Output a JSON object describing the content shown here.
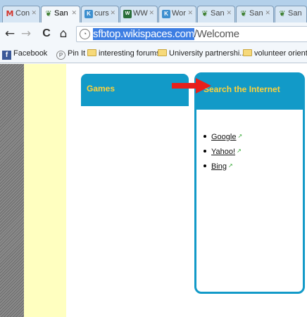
{
  "tabs": [
    {
      "label": "Con",
      "icon": "gmail-icon",
      "glyph": "M",
      "active": false
    },
    {
      "label": "San",
      "icon": "plant-icon",
      "glyph": "❦",
      "active": true
    },
    {
      "label": "curs",
      "icon": "k12-icon",
      "glyph": "K",
      "active": false
    },
    {
      "label": "WW",
      "icon": "ww-icon",
      "glyph": "W",
      "active": false
    },
    {
      "label": "Wor",
      "icon": "k12-icon",
      "glyph": "K",
      "active": false
    },
    {
      "label": "San",
      "icon": "plant-icon",
      "glyph": "❦",
      "active": false
    },
    {
      "label": "San",
      "icon": "plant-icon",
      "glyph": "❦",
      "active": false
    },
    {
      "label": "San",
      "icon": "plant-icon",
      "glyph": "❦",
      "active": false
    }
  ],
  "nav": {
    "back": "←",
    "forward": "→",
    "reload": "C",
    "home": "⌂"
  },
  "omnibox": {
    "url_selected": "sfbtop.wikispaces.com",
    "url_rest": "/Welcome"
  },
  "bookmarks": [
    {
      "label": "Facebook",
      "icon": "facebook-icon"
    },
    {
      "label": "Pin It",
      "icon": "pinit-icon"
    },
    {
      "label": "interesting forums",
      "icon": "folder-icon"
    },
    {
      "label": "University partnershi...",
      "icon": "folder-icon"
    },
    {
      "label": "volunteer orientations",
      "icon": "folder-icon"
    }
  ],
  "page": {
    "games_title": "Games",
    "search_title": "Search the Internet",
    "search_links": [
      "Google",
      "Yahoo!",
      "Bing"
    ]
  },
  "colors": {
    "box_blue": "#129ac8",
    "heading_yellow": "#ffd23a",
    "left_column": "#ffffc0",
    "arrow_red": "#e8201b",
    "selection_blue": "#3d7ee3"
  }
}
